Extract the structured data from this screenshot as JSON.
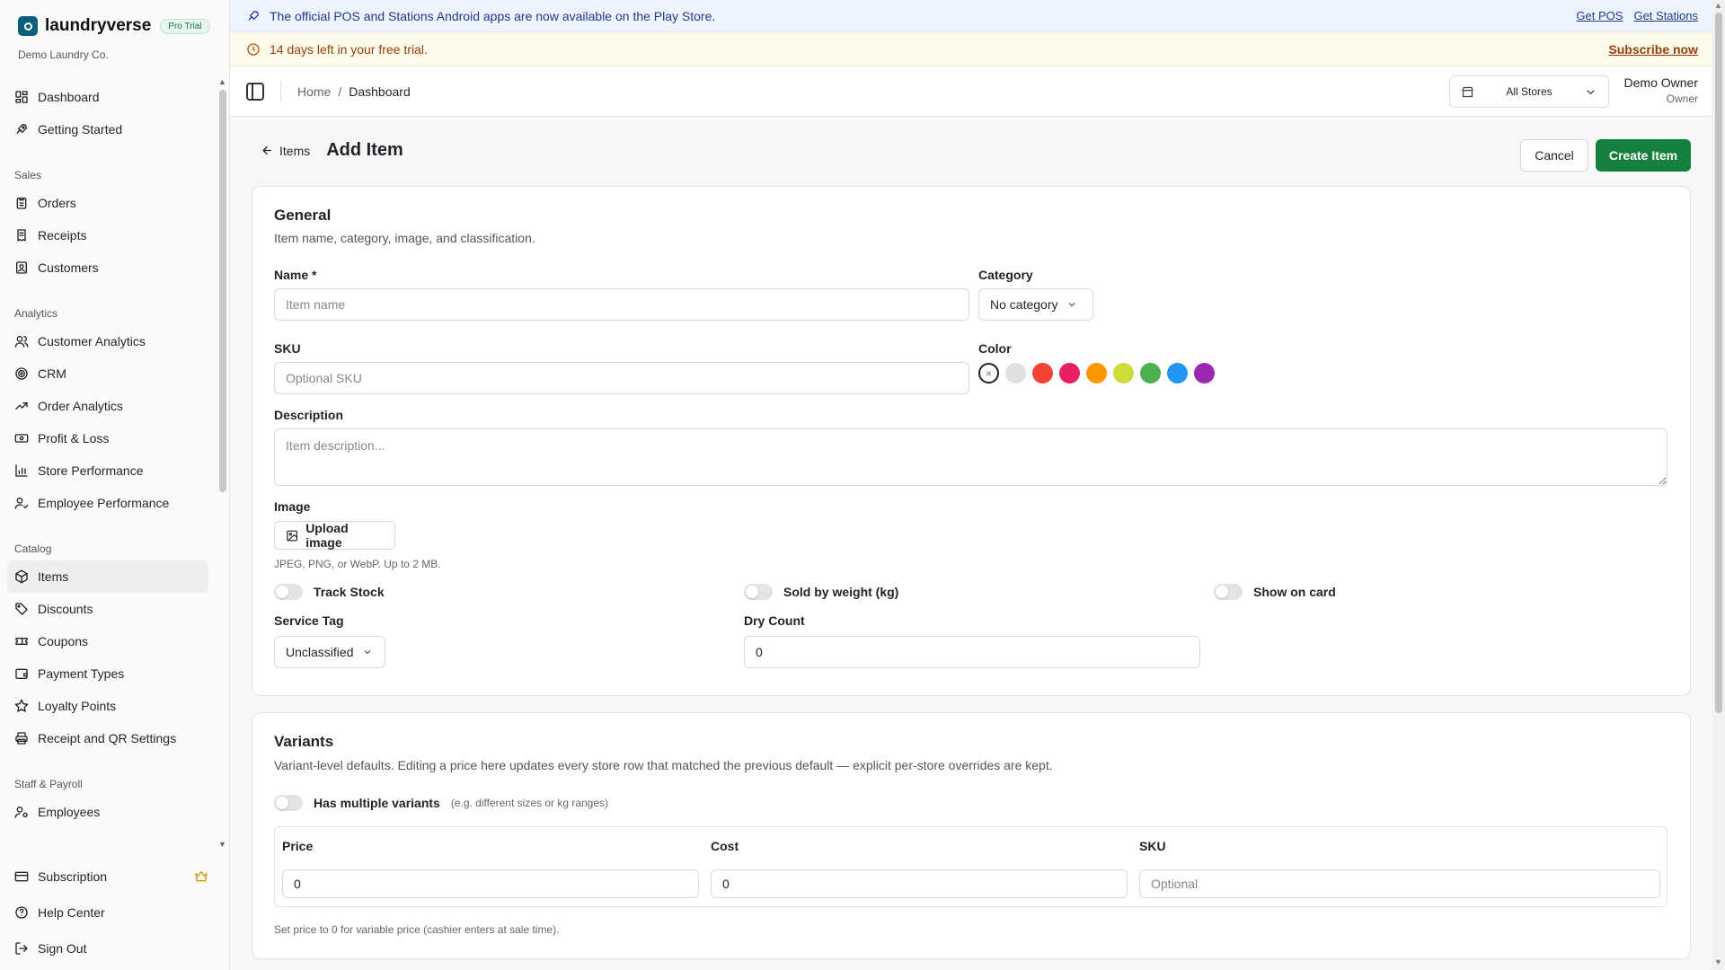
{
  "brand": {
    "name": "laundryverse",
    "badge": "Pro Trial",
    "org": "Demo Laundry Co."
  },
  "nav": {
    "top": [
      {
        "label": "Dashboard",
        "icon": "dashboard-icon"
      },
      {
        "label": "Getting Started",
        "icon": "rocket-icon"
      }
    ],
    "sections": [
      {
        "title": "Sales",
        "items": [
          {
            "label": "Orders",
            "icon": "clipboard-icon"
          },
          {
            "label": "Receipts",
            "icon": "receipt-icon"
          },
          {
            "label": "Customers",
            "icon": "contact-icon"
          }
        ]
      },
      {
        "title": "Analytics",
        "items": [
          {
            "label": "Customer Analytics",
            "icon": "users-icon"
          },
          {
            "label": "CRM",
            "icon": "target-icon"
          },
          {
            "label": "Order Analytics",
            "icon": "trending-up-icon"
          },
          {
            "label": "Profit & Loss",
            "icon": "banknote-icon"
          },
          {
            "label": "Store Performance",
            "icon": "bar-chart-icon"
          },
          {
            "label": "Employee Performance",
            "icon": "user-check-icon"
          }
        ]
      },
      {
        "title": "Catalog",
        "items": [
          {
            "label": "Items",
            "icon": "package-icon",
            "active": true
          },
          {
            "label": "Discounts",
            "icon": "tag-icon"
          },
          {
            "label": "Coupons",
            "icon": "ticket-icon"
          },
          {
            "label": "Payment Types",
            "icon": "wallet-icon"
          },
          {
            "label": "Loyalty Points",
            "icon": "star-icon"
          },
          {
            "label": "Receipt and QR Settings",
            "icon": "printer-icon"
          }
        ]
      },
      {
        "title": "Staff & Payroll",
        "items": [
          {
            "label": "Employees",
            "icon": "user-cog-icon"
          }
        ]
      }
    ],
    "footer": [
      {
        "label": "Subscription",
        "icon": "credit-card-icon"
      },
      {
        "label": "Help Center",
        "icon": "help-circle-icon"
      },
      {
        "label": "Sign Out",
        "icon": "log-out-icon"
      }
    ]
  },
  "banners": {
    "apps": {
      "text": "The official POS and Stations Android apps are now available on the Play Store.",
      "link1": "Get POS",
      "link2": "Get Stations"
    },
    "trial": {
      "text": "14 days left in your free trial.",
      "link": "Subscribe now"
    }
  },
  "topbar": {
    "breadcrumb_home": "Home",
    "breadcrumb_sep": "/",
    "breadcrumb_current": "Dashboard",
    "store": "All Stores",
    "user_name": "Demo Owner",
    "user_role": "Owner"
  },
  "page": {
    "back_label": "Items",
    "title": "Add Item",
    "cancel": "Cancel",
    "create": "Create Item"
  },
  "general": {
    "title": "General",
    "subtitle": "Item name, category, image, and classification.",
    "name_label": "Name *",
    "name_placeholder": "Item name",
    "category_label": "Category",
    "category_value": "No category",
    "sku_label": "SKU",
    "sku_placeholder": "Optional SKU",
    "color_label": "Color",
    "colors": [
      "#e0e0e0",
      "#f44336",
      "#e91e63",
      "#ff9800",
      "#cddc39",
      "#4caf50",
      "#2196f3",
      "#9c27b0"
    ],
    "description_label": "Description",
    "description_placeholder": "Item description...",
    "image_label": "Image",
    "upload_label": "Upload image",
    "image_hint": "JPEG, PNG, or WebP. Up to 2 MB.",
    "track_stock": "Track Stock",
    "sold_by_weight": "Sold by weight (kg)",
    "show_on_card": "Show on card",
    "service_tag_label": "Service Tag",
    "service_tag_value": "Unclassified",
    "dry_count_label": "Dry Count",
    "dry_count_value": "0"
  },
  "variants": {
    "title": "Variants",
    "subtitle": "Variant-level defaults. Editing a price here updates every store row that matched the previous default — explicit per-store overrides are kept.",
    "multi_label": "Has multiple variants",
    "multi_hint": "(e.g. different sizes or kg ranges)",
    "price_label": "Price",
    "cost_label": "Cost",
    "sku_label": "SKU",
    "price_value": "0",
    "cost_value": "0",
    "sku_placeholder": "Optional",
    "hint": "Set price to 0 for variable price (cashier enters at sale time)."
  }
}
